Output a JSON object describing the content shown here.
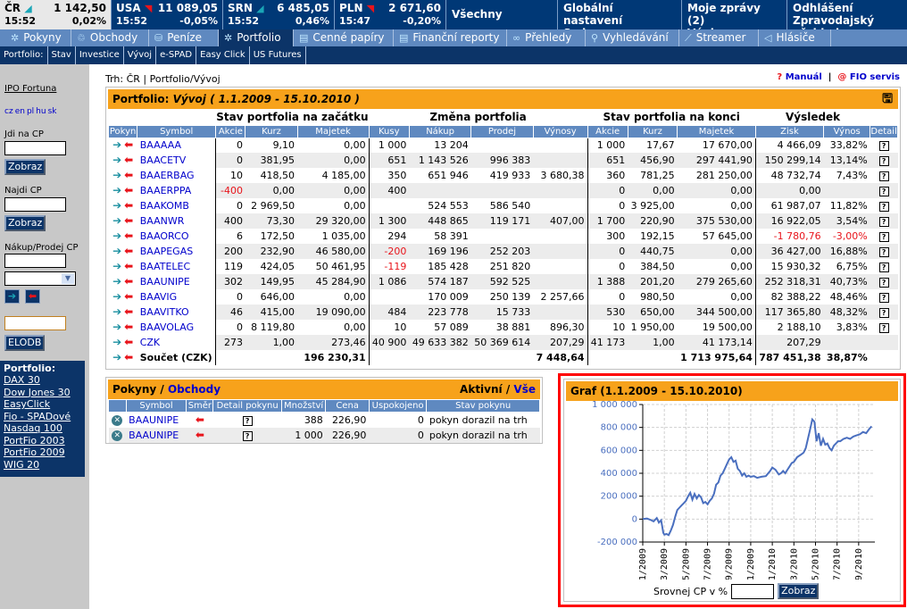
{
  "ticker": [
    {
      "name": "ČR",
      "trend": "up",
      "value": "1 142,50",
      "time": "15:52",
      "change": "0,02%"
    },
    {
      "name": "USA",
      "trend": "down",
      "value": "11 089,05",
      "time": "15:52",
      "change": "-0,05%"
    },
    {
      "name": "SRN",
      "trend": "up",
      "value": "6 485,05",
      "time": "15:52",
      "change": "0,46%"
    },
    {
      "name": "PLN",
      "trend": "down",
      "value": "2 671,60",
      "time": "15:47",
      "change": "-0,20%"
    }
  ],
  "top_menu": {
    "all": "Všechny",
    "global_settings": "Globální nastavení",
    "contracts": "Smlouvy",
    "messages": "Moje zprávy (2)",
    "statements": "Výpisy",
    "logout": "Odhlášení",
    "news": "Zpravodajský přehled"
  },
  "main_nav": [
    {
      "label": "Pokyny",
      "icon": "orders-icon"
    },
    {
      "label": "Obchody",
      "icon": "trades-icon"
    },
    {
      "label": "Peníze",
      "icon": "money-icon"
    },
    {
      "label": "Portfolio",
      "icon": "portfolio-icon",
      "active": true
    },
    {
      "label": "Cenné papíry",
      "icon": "securities-icon"
    },
    {
      "label": "Finanční reporty",
      "icon": "reports-icon"
    },
    {
      "label": "Přehledy",
      "icon": "glasses-icon"
    },
    {
      "label": "Vyhledávání",
      "icon": "search-icon"
    },
    {
      "label": "Streamer",
      "icon": "chart-icon"
    },
    {
      "label": "Hlásiče",
      "icon": "megaphone-icon"
    }
  ],
  "sub_nav": {
    "label": "Portfolio:",
    "items": [
      "Stav",
      "Investice",
      "Vývoj",
      "e-SPAD",
      "Easy Click",
      "US Futures"
    ]
  },
  "sidebar": {
    "ipo_link": "IPO Fortuna",
    "languages": [
      "cz",
      "en",
      "pl",
      "hu",
      "sk"
    ],
    "goto_label": "Jdi na CP",
    "goto_value": "",
    "find_label": "Najdi CP",
    "find_value": "",
    "trade_label": "Nákup/Prodej CP",
    "trade_value": "",
    "trade_select": "",
    "show_button": "Zobraz",
    "elodb_value": "",
    "elodb_button": "ELODB",
    "portfolio_title": "Portfolio:",
    "portfolios": [
      "DAX 30",
      "Dow Jones 30",
      "EasyClick",
      "Fio - SPADové",
      "Nasdaq 100",
      "PortFio 2003",
      "PortFio 2009",
      "WIG 20"
    ]
  },
  "breadcrumb": "Trh: ČR | Portfolio/Vývoj",
  "help_links": {
    "manual_prefix": "?",
    "manual": "Manuál",
    "sep": "|",
    "service_prefix": "@",
    "service": "FIO servis"
  },
  "portfolio": {
    "title_prefix": "Portfolio:",
    "title_period": "Vývoj ( 1.1.2009 - 15.10.2010 )",
    "groups": {
      "start": "Stav portfolia na začátku",
      "change": "Změna portfolia",
      "end": "Stav portfolia na konci",
      "result": "Výsledek"
    },
    "columns": [
      "Pokyn",
      "Symbol",
      "Akcie",
      "Kurz",
      "Majetek",
      "Kusy",
      "Nákup",
      "Prodej",
      "Výnosy",
      "Akcie",
      "Kurz",
      "Majetek",
      "Zisk",
      "Výnos",
      "Detail"
    ],
    "rows": [
      {
        "symbol": "BAAAAA",
        "s_akcie": "0",
        "s_kurz": "9,10",
        "s_majetek": "0,00",
        "kusy": "1 000",
        "nakup": "13 204",
        "prodej": "",
        "vynosy": "",
        "e_akcie": "1 000",
        "e_kurz": "17,67",
        "e_majetek": "17 670,00",
        "zisk": "4 466,09",
        "vynos": "33,82%",
        "detail": true
      },
      {
        "symbol": "BAACETV",
        "s_akcie": "0",
        "s_kurz": "381,95",
        "s_majetek": "0,00",
        "kusy": "651",
        "nakup": "1 143 526",
        "prodej": "996 383",
        "vynosy": "",
        "e_akcie": "651",
        "e_kurz": "456,90",
        "e_majetek": "297 441,90",
        "zisk": "150 299,14",
        "vynos": "13,14%",
        "detail": true
      },
      {
        "symbol": "BAAERBAG",
        "s_akcie": "10",
        "s_kurz": "418,50",
        "s_majetek": "4 185,00",
        "kusy": "350",
        "nakup": "651 946",
        "prodej": "419 933",
        "vynosy": "3 680,38",
        "e_akcie": "360",
        "e_kurz": "781,25",
        "e_majetek": "281 250,00",
        "zisk": "48 732,74",
        "vynos": "7,43%",
        "detail": true
      },
      {
        "symbol": "BAAERPPA",
        "s_akcie": "-400",
        "s_kurz": "0,00",
        "s_majetek": "0,00",
        "kusy": "400",
        "nakup": "",
        "prodej": "",
        "vynosy": "",
        "e_akcie": "0",
        "e_kurz": "0,00",
        "e_majetek": "0,00",
        "zisk": "0,00",
        "vynos": "",
        "detail": true
      },
      {
        "symbol": "BAAKOMB",
        "s_akcie": "0",
        "s_kurz": "2 969,50",
        "s_majetek": "0,00",
        "kusy": "",
        "nakup": "524 553",
        "prodej": "586 540",
        "vynosy": "",
        "e_akcie": "0",
        "e_kurz": "3 925,00",
        "e_majetek": "0,00",
        "zisk": "61 987,07",
        "vynos": "11,82%",
        "detail": true
      },
      {
        "symbol": "BAANWR",
        "s_akcie": "400",
        "s_kurz": "73,30",
        "s_majetek": "29 320,00",
        "kusy": "1 300",
        "nakup": "448 865",
        "prodej": "119 171",
        "vynosy": "407,00",
        "e_akcie": "1 700",
        "e_kurz": "220,90",
        "e_majetek": "375 530,00",
        "zisk": "16 922,05",
        "vynos": "3,54%",
        "detail": true
      },
      {
        "symbol": "BAAORCO",
        "s_akcie": "6",
        "s_kurz": "172,50",
        "s_majetek": "1 035,00",
        "kusy": "294",
        "nakup": "58 391",
        "prodej": "",
        "vynosy": "",
        "e_akcie": "300",
        "e_kurz": "192,15",
        "e_majetek": "57 645,00",
        "zisk": "-1 780,76",
        "vynos": "-3,00%",
        "detail": true
      },
      {
        "symbol": "BAAPEGAS",
        "s_akcie": "200",
        "s_kurz": "232,90",
        "s_majetek": "46 580,00",
        "kusy": "-200",
        "nakup": "169 196",
        "prodej": "252 203",
        "vynosy": "",
        "e_akcie": "0",
        "e_kurz": "440,75",
        "e_majetek": "0,00",
        "zisk": "36 427,00",
        "vynos": "16,88%",
        "detail": true
      },
      {
        "symbol": "BAATELEC",
        "s_akcie": "119",
        "s_kurz": "424,05",
        "s_majetek": "50 461,95",
        "kusy": "-119",
        "nakup": "185 428",
        "prodej": "251 820",
        "vynosy": "",
        "e_akcie": "0",
        "e_kurz": "384,50",
        "e_majetek": "0,00",
        "zisk": "15 930,32",
        "vynos": "6,75%",
        "detail": true
      },
      {
        "symbol": "BAAUNIPE",
        "s_akcie": "302",
        "s_kurz": "149,95",
        "s_majetek": "45 284,90",
        "kusy": "1 086",
        "nakup": "574 187",
        "prodej": "592 525",
        "vynosy": "",
        "e_akcie": "1 388",
        "e_kurz": "201,20",
        "e_majetek": "279 265,60",
        "zisk": "252 318,31",
        "vynos": "40,73%",
        "detail": true
      },
      {
        "symbol": "BAAVIG",
        "s_akcie": "0",
        "s_kurz": "646,00",
        "s_majetek": "0,00",
        "kusy": "",
        "nakup": "170 009",
        "prodej": "250 139",
        "vynosy": "2 257,66",
        "e_akcie": "0",
        "e_kurz": "980,50",
        "e_majetek": "0,00",
        "zisk": "82 388,22",
        "vynos": "48,46%",
        "detail": true
      },
      {
        "symbol": "BAAVITKO",
        "s_akcie": "46",
        "s_kurz": "415,00",
        "s_majetek": "19 090,00",
        "kusy": "484",
        "nakup": "223 778",
        "prodej": "15 733",
        "vynosy": "",
        "e_akcie": "530",
        "e_kurz": "650,00",
        "e_majetek": "344 500,00",
        "zisk": "117 365,80",
        "vynos": "48,32%",
        "detail": true
      },
      {
        "symbol": "BAAVOLAG",
        "s_akcie": "0",
        "s_kurz": "8 119,80",
        "s_majetek": "0,00",
        "kusy": "10",
        "nakup": "57 089",
        "prodej": "38 881",
        "vynosy": "896,30",
        "e_akcie": "10",
        "e_kurz": "1 950,00",
        "e_majetek": "19 500,00",
        "zisk": "2 188,10",
        "vynos": "3,83%",
        "detail": true
      },
      {
        "symbol": "CZK",
        "s_akcie": "273",
        "s_kurz": "1,00",
        "s_majetek": "273,46",
        "kusy": "40 900",
        "nakup": "49 633 382",
        "prodej": "50 369 614",
        "vynosy": "207,29",
        "e_akcie": "41 173",
        "e_kurz": "1,00",
        "e_majetek": "41 173,14",
        "zisk": "207,29",
        "vynos": "",
        "detail": false
      }
    ],
    "total": {
      "label": "Součet (CZK)",
      "s_majetek": "196 230,31",
      "vynosy": "7 448,64",
      "e_majetek": "1 713 975,64",
      "zisk": "787 451,38",
      "vynos": "38,87%"
    }
  },
  "orders": {
    "title": "Pokyny",
    "sep": "/",
    "trades_link": "Obchody",
    "active": "Aktivní",
    "all_link": "Vše",
    "columns": [
      "",
      "Symbol",
      "Směr",
      "Detail pokynu",
      "Množství",
      "Cena",
      "Uspokojeno",
      "Stav pokynu"
    ],
    "rows": [
      {
        "symbol": "BAAUNIPE",
        "direction": "sell",
        "qty": "388",
        "price": "226,90",
        "filled": "0",
        "status": "pokyn dorazil na trh"
      },
      {
        "symbol": "BAAUNIPE",
        "direction": "sell",
        "qty": "1 000",
        "price": "226,90",
        "filled": "0",
        "status": "pokyn dorazil na trh"
      }
    ]
  },
  "graph": {
    "title": "Graf (1.1.2009 - 15.10.2010)",
    "compare_label": "Srovnej CP v %",
    "compare_value": "",
    "compare_button": "Zobraz"
  },
  "chart_data": {
    "type": "line",
    "title": "Graf (1.1.2009 - 15.10.2010)",
    "xlabel": "",
    "ylabel": "",
    "ylim": [
      -200000,
      1000000
    ],
    "yticks": [
      "-200 000",
      "0",
      "200 000",
      "400 000",
      "600 000",
      "800 000",
      "1 000 000"
    ],
    "ytick_values": [
      -200000,
      0,
      200000,
      400000,
      600000,
      800000,
      1000000
    ],
    "xticks": [
      "01/2009",
      "03/2009",
      "05/2009",
      "07/2009",
      "09/2009",
      "11/2009",
      "01/2010",
      "03/2010",
      "05/2010",
      "07/2010",
      "09/2010"
    ],
    "xlim_months": [
      0,
      21.5
    ],
    "grid": true,
    "color": "#4a6fbf",
    "series": [
      {
        "name": "Portfolio",
        "x_months": [
          0,
          0.4,
          0.8,
          1.0,
          1.3,
          1.5,
          1.7,
          1.9,
          2.0,
          2.2,
          2.4,
          2.6,
          2.8,
          3.0,
          3.2,
          3.4,
          3.6,
          3.8,
          4.0,
          4.2,
          4.4,
          4.6,
          4.8,
          5.0,
          5.2,
          5.4,
          5.6,
          5.8,
          6.0,
          6.2,
          6.4,
          6.6,
          6.8,
          7.0,
          7.2,
          7.4,
          7.6,
          7.8,
          8.0,
          8.2,
          8.4,
          8.6,
          8.8,
          9.0,
          9.2,
          9.4,
          9.6,
          9.8,
          10.0,
          10.3,
          10.6,
          11.0,
          11.4,
          11.8,
          12.0,
          12.3,
          12.6,
          12.8,
          13.0,
          13.2,
          13.4,
          13.6,
          13.8,
          14.0,
          14.3,
          14.6,
          14.9,
          15.1,
          15.3,
          15.5,
          15.7,
          15.9,
          16.1,
          16.3,
          16.5,
          16.7,
          16.9,
          17.1,
          17.3,
          17.5,
          17.7,
          17.9,
          18.1,
          18.3,
          18.6,
          18.9,
          19.2,
          19.5,
          19.8,
          20.1,
          20.4,
          20.7,
          21.0,
          21.2
        ],
        "values": [
          0,
          5000,
          -10000,
          -20000,
          10000,
          -30000,
          -10000,
          -120000,
          -135000,
          -130000,
          -140000,
          -100000,
          -50000,
          20000,
          80000,
          100000,
          120000,
          140000,
          160000,
          200000,
          230000,
          170000,
          220000,
          180000,
          210000,
          190000,
          140000,
          150000,
          130000,
          160000,
          180000,
          220000,
          300000,
          320000,
          380000,
          400000,
          440000,
          480000,
          520000,
          540000,
          500000,
          510000,
          440000,
          420000,
          380000,
          400000,
          370000,
          380000,
          370000,
          375000,
          360000,
          370000,
          375000,
          420000,
          450000,
          430000,
          390000,
          400000,
          420000,
          400000,
          430000,
          460000,
          490000,
          500000,
          540000,
          560000,
          580000,
          620000,
          700000,
          780000,
          870000,
          850000,
          680000,
          750000,
          640000,
          700000,
          650000,
          660000,
          620000,
          600000,
          640000,
          660000,
          680000,
          680000,
          700000,
          710000,
          700000,
          720000,
          730000,
          740000,
          760000,
          750000,
          790000,
          810000
        ]
      }
    ]
  }
}
